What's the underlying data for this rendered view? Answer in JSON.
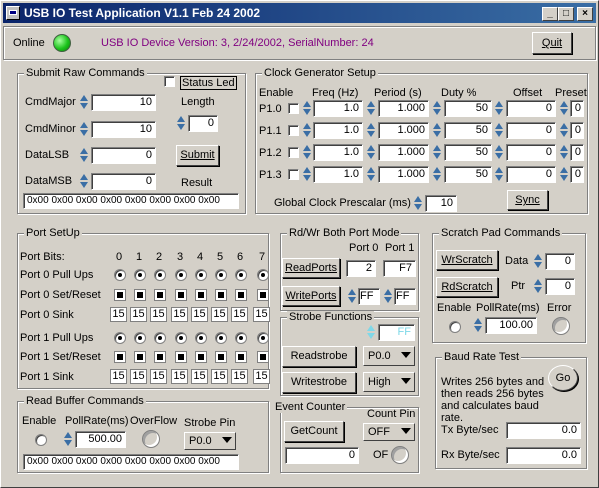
{
  "window": {
    "title": "USB IO Test Application    V1.1  Feb 24 2002",
    "minimize": "_",
    "maximize": "□",
    "close": "×"
  },
  "status": {
    "online_label": "Online",
    "device_info": "USB IO Device Version: 3,  2/24/2002,  SerialNumber: 24",
    "quit_label": "Quit",
    "online_color": "#1cc41c"
  },
  "raw": {
    "title": "Submit Raw Commands",
    "status_led_label": "Status Led",
    "cmdmajor_label": "CmdMajor",
    "cmdmajor": "10",
    "cmdminor_label": "CmdMinor",
    "cmdminor": "10",
    "datalsb_label": "DataLSB",
    "datalsb": "0",
    "datamsb_label": "DataMSB",
    "datamsb": "0",
    "length_label": "Length",
    "length": "0",
    "submit_label": "Submit",
    "result_label": "Result",
    "result": "0x00 0x00 0x00 0x00 0x00 0x00 0x00 0x00"
  },
  "clock": {
    "title": "Clock Generator Setup",
    "enable_label": "Enable",
    "freq_label": "Freq (Hz)",
    "period_label": "Period (s)",
    "duty_label": "Duty %",
    "offset_label": "Offset",
    "preset_label": "Preset",
    "rows": [
      {
        "name": "P1.0",
        "freq": "1.0",
        "period": "1.000",
        "duty": "50",
        "offset": "0",
        "preset": "0"
      },
      {
        "name": "P1.1",
        "freq": "1.0",
        "period": "1.000",
        "duty": "50",
        "offset": "0",
        "preset": "0"
      },
      {
        "name": "P1.2",
        "freq": "1.0",
        "period": "1.000",
        "duty": "50",
        "offset": "0",
        "preset": "0"
      },
      {
        "name": "P1.3",
        "freq": "1.0",
        "period": "1.000",
        "duty": "50",
        "offset": "0",
        "preset": "0"
      }
    ],
    "prescalar_label": "Global Clock Prescalar (ms)",
    "prescalar": "10",
    "sync_label": "Sync"
  },
  "port": {
    "title": "Port SetUp",
    "bits_label": "Port Bits:",
    "bits": [
      "0",
      "1",
      "2",
      "3",
      "4",
      "5",
      "6",
      "7"
    ],
    "p0_pullups": "Port 0 Pull Ups",
    "p0_setreset": "Port 0 Set/Reset",
    "p0_sink": "Port 0 Sink",
    "p1_pullups": "Port 1 Pull Ups",
    "p1_setreset": "Port 1 Set/Reset",
    "p1_sink": "Port 1 Sink",
    "sink_value": "15"
  },
  "rdwr": {
    "title": "Rd/Wr Both Port Mode",
    "port0_label": "Port 0",
    "port1_label": "Port 1",
    "readports_label": "ReadPorts",
    "read_p0": "2",
    "read_p1": "F7",
    "writeports_label": "WritePorts",
    "write_p0": "FF",
    "write_p1": "FF"
  },
  "strobe": {
    "title": "Strobe Functions",
    "value": "FF",
    "readstrobe_label": "Readstrobe",
    "readstrobe_pin": "P0.0",
    "writestrobe_label": "Writestrobe",
    "writestrobe_level": "High"
  },
  "scratch": {
    "title": "Scratch Pad Commands",
    "wrscratch_label": "WrScratch",
    "data_label": "Data",
    "data": "0",
    "rdscratch_label": "RdScratch",
    "ptr_label": "Ptr",
    "ptr": "0",
    "enable_label": "Enable",
    "pollrate_label": "PollRate(ms)",
    "error_label": "Error",
    "pollrate": "100.00"
  },
  "readbuf": {
    "title": "Read Buffer Commands",
    "enable_label": "Enable",
    "pollrate_label": "PollRate(ms)",
    "overflow_label": "OverFlow",
    "strobepin_label": "Strobe Pin",
    "pollrate": "500.00",
    "strobepin": "P0.0",
    "result": "0x00 0x00 0x00 0x00 0x00 0x00 0x00 0x00"
  },
  "event": {
    "title": "Event Counter",
    "countpin_label": "Count Pin",
    "getcount_label": "GetCount",
    "countpin": "OFF",
    "count": "0",
    "of_label": "OF"
  },
  "baud": {
    "title": "Baud Rate Test",
    "go_label": "Go",
    "desc": "Writes 256 bytes and then reads 256 bytes and calculates baud rate.",
    "tx_label": "Tx Byte/sec",
    "tx": "0.0",
    "rx_label": "Rx Byte/sec",
    "rx": "0.0"
  }
}
